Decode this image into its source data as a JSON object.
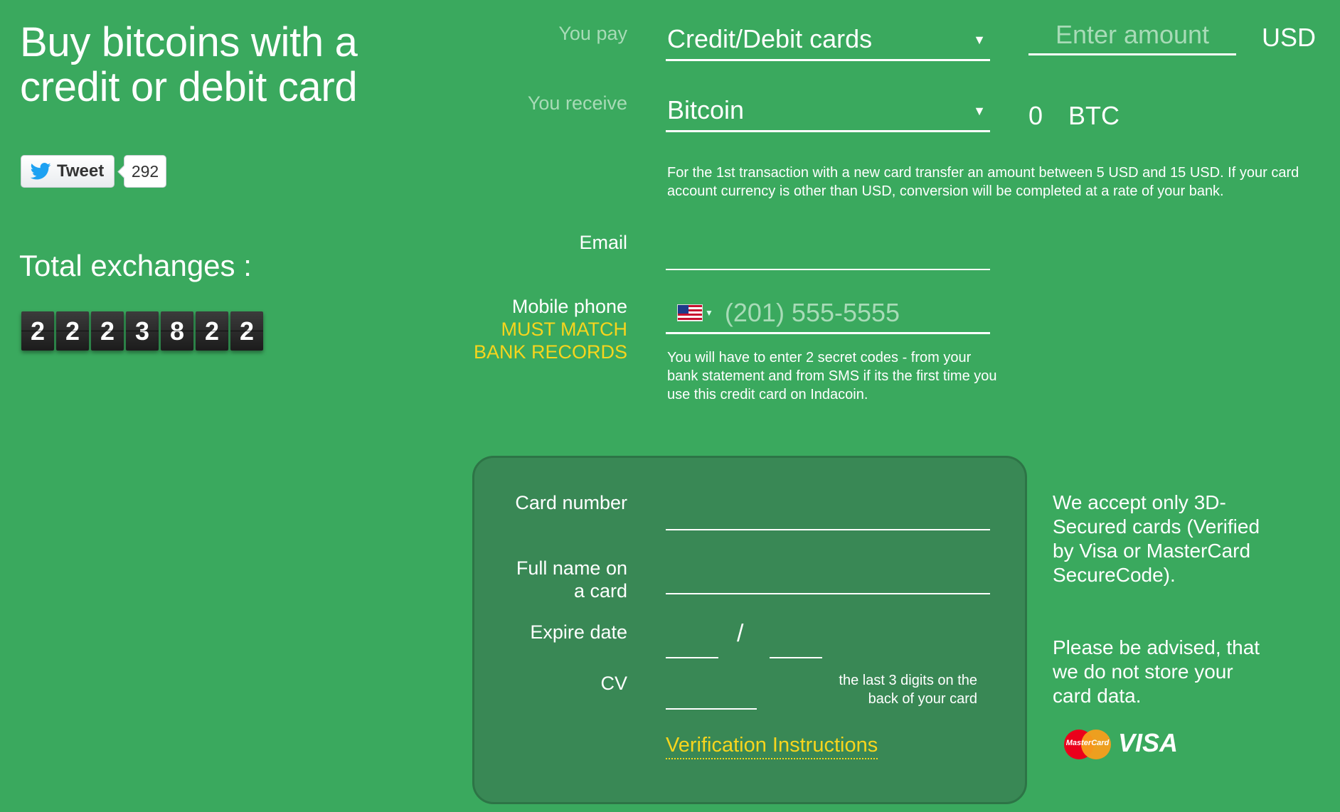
{
  "left": {
    "title": "Buy bitcoins with a credit or debit card",
    "tweet_label": "Tweet",
    "tweet_count": "292",
    "total_label": "Total exchanges :",
    "counter_digits": [
      "2",
      "2",
      "2",
      "3",
      "8",
      "2",
      "2"
    ]
  },
  "pay": {
    "label": "You pay",
    "method": "Credit/Debit cards",
    "amount_placeholder": "Enter amount",
    "currency": "USD"
  },
  "receive": {
    "label": "You receive",
    "asset": "Bitcoin",
    "amount": "0",
    "currency": "BTC"
  },
  "transaction_note": "For the 1st transaction with a new card transfer an amount between 5 USD and 15 USD. If your card account currency is other than USD, conversion will be completed at a rate of your bank.",
  "email": {
    "label": "Email"
  },
  "phone": {
    "label": "Mobile phone",
    "warning_line1": "MUST MATCH",
    "warning_line2": "BANK RECORDS",
    "placeholder": "(201) 555-5555",
    "note": "You will have to enter 2 secret codes - from your bank statement and from SMS if its the first time you use this credit card on Indacoin."
  },
  "card": {
    "number_label": "Card number",
    "name_label_line1": "Full name on",
    "name_label_line2": "a card",
    "expire_label": "Expire date",
    "expire_separator": "/",
    "cv_label": "CV",
    "cv_hint_line1": "the last 3 digits on the",
    "cv_hint_line2": "back of your card",
    "verification_link": "Verification Instructions"
  },
  "side": {
    "accept_note": "We accept only 3D-Secured cards (Verified by Visa or MasterCard SecureCode).",
    "store_note": "Please be advised, that we do not store your card data.",
    "mastercard_text": "MasterCard",
    "visa_text": "VISA"
  },
  "colors": {
    "background": "#3aa95e",
    "card_panel": "#398855",
    "accent_yellow": "#f7d51d",
    "muted_label": "#a8dbb7"
  },
  "icons": [
    "twitter-bird-icon",
    "dropdown-arrow-icon",
    "us-flag-icon",
    "mastercard-logo",
    "visa-logo"
  ]
}
